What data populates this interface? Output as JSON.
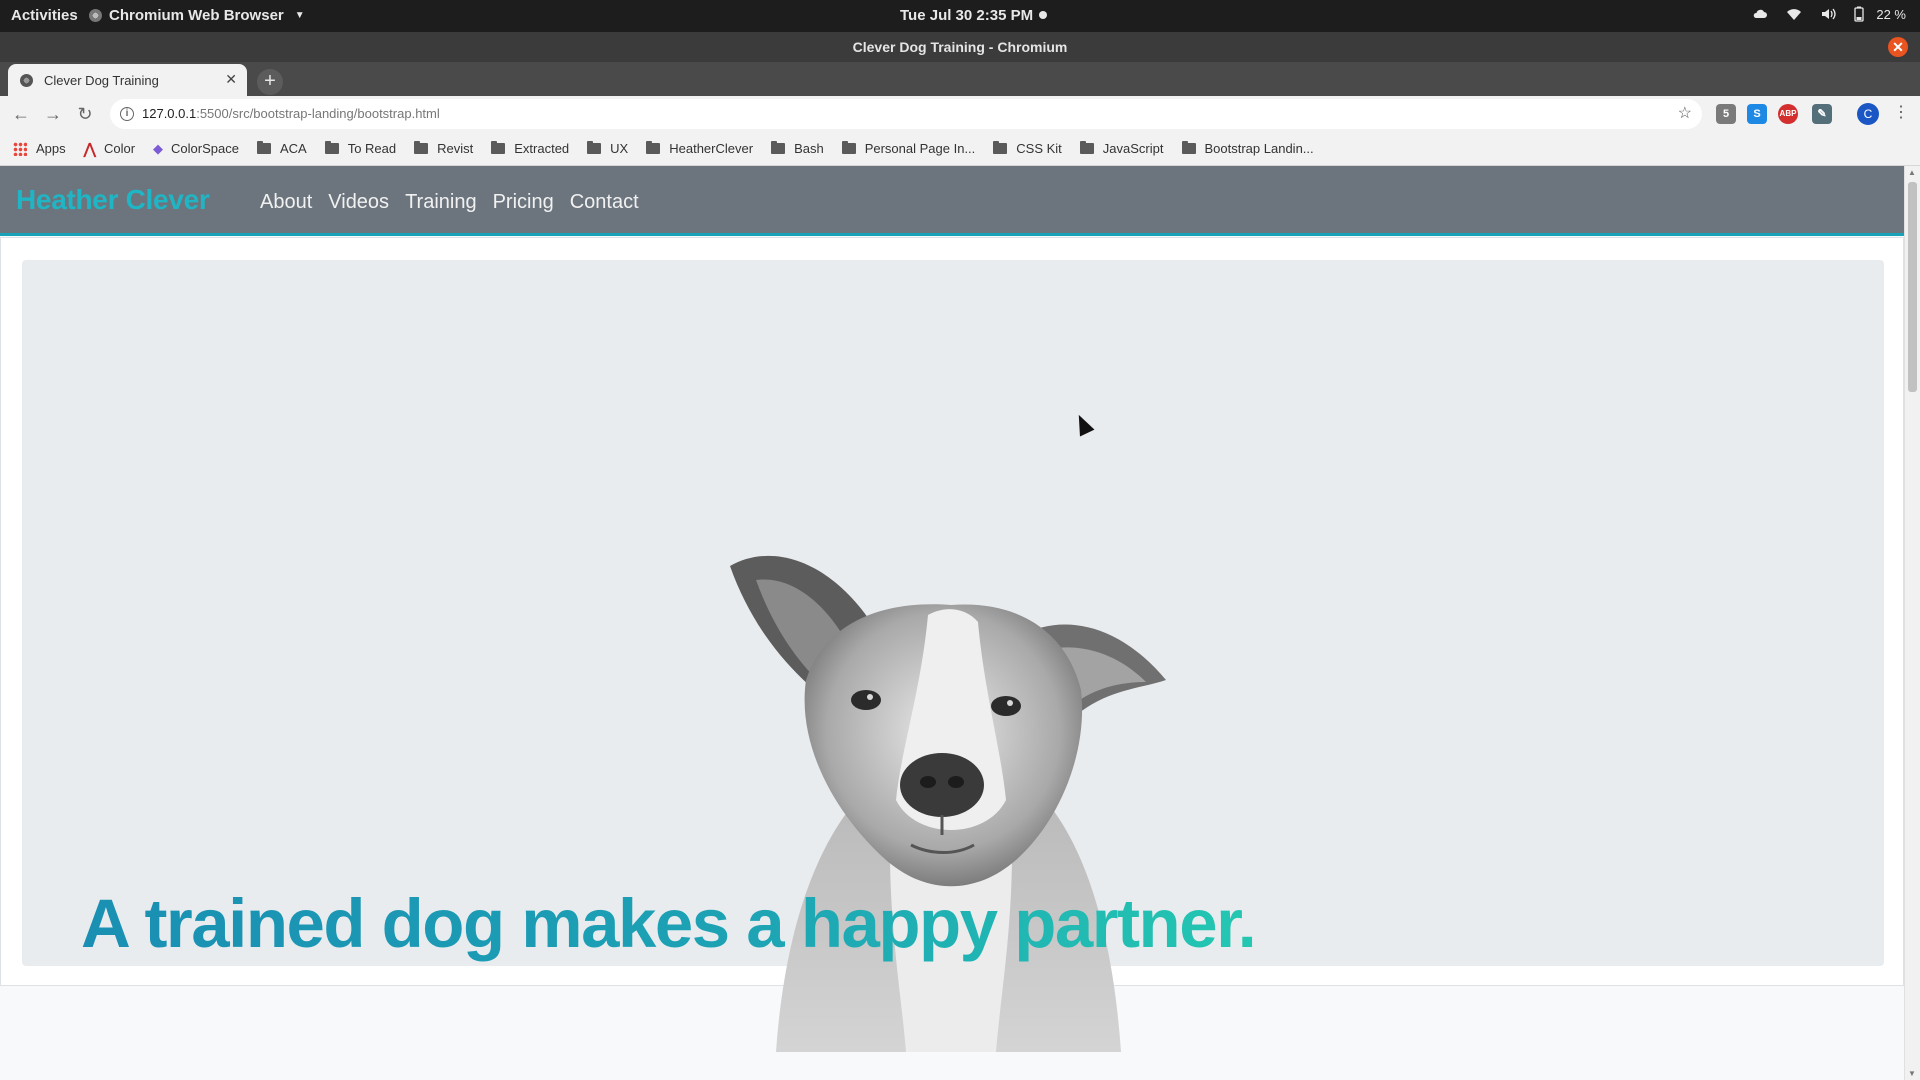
{
  "system_bar": {
    "activities": "Activities",
    "app_name": "Chromium Web Browser",
    "clock": "Tue Jul 30   2:35 PM",
    "battery": "22 %"
  },
  "window": {
    "title": "Clever Dog Training - Chromium"
  },
  "tabs": [
    {
      "title": "Clever Dog Training"
    }
  ],
  "address_bar": {
    "host": "127.0.0.1",
    "path": ":5500/src/bootstrap-landing/bootstrap.html"
  },
  "extensions": {
    "badge_count": "5",
    "profile_initial": "C"
  },
  "bookmarks": [
    {
      "label": "Apps",
      "icon": "apps-grid-icon"
    },
    {
      "label": "Color",
      "icon": "adobe-color-icon"
    },
    {
      "label": "ColorSpace",
      "icon": "colorspace-icon"
    },
    {
      "label": "ACA",
      "icon": "folder-icon"
    },
    {
      "label": "To Read",
      "icon": "folder-icon"
    },
    {
      "label": "Revist",
      "icon": "folder-icon"
    },
    {
      "label": "Extracted",
      "icon": "folder-icon"
    },
    {
      "label": "UX",
      "icon": "folder-icon"
    },
    {
      "label": "HeatherClever",
      "icon": "folder-icon"
    },
    {
      "label": "Bash",
      "icon": "folder-icon"
    },
    {
      "label": "Personal Page In...",
      "icon": "folder-icon"
    },
    {
      "label": "CSS Kit",
      "icon": "folder-icon"
    },
    {
      "label": "JavaScript",
      "icon": "folder-icon"
    },
    {
      "label": "Bootstrap Landin...",
      "icon": "folder-icon"
    }
  ],
  "site": {
    "brand": "Heather Clever",
    "nav": [
      "About",
      "Videos",
      "Training",
      "Pricing",
      "Contact"
    ],
    "headline": "A trained dog makes a happy partner.",
    "colors": {
      "navbar": "#6c757d",
      "brand": "#1fb5c4",
      "accent_border": "#17a2b8",
      "headline_start": "#1a8fb3",
      "headline_end": "#24c7b2"
    }
  }
}
